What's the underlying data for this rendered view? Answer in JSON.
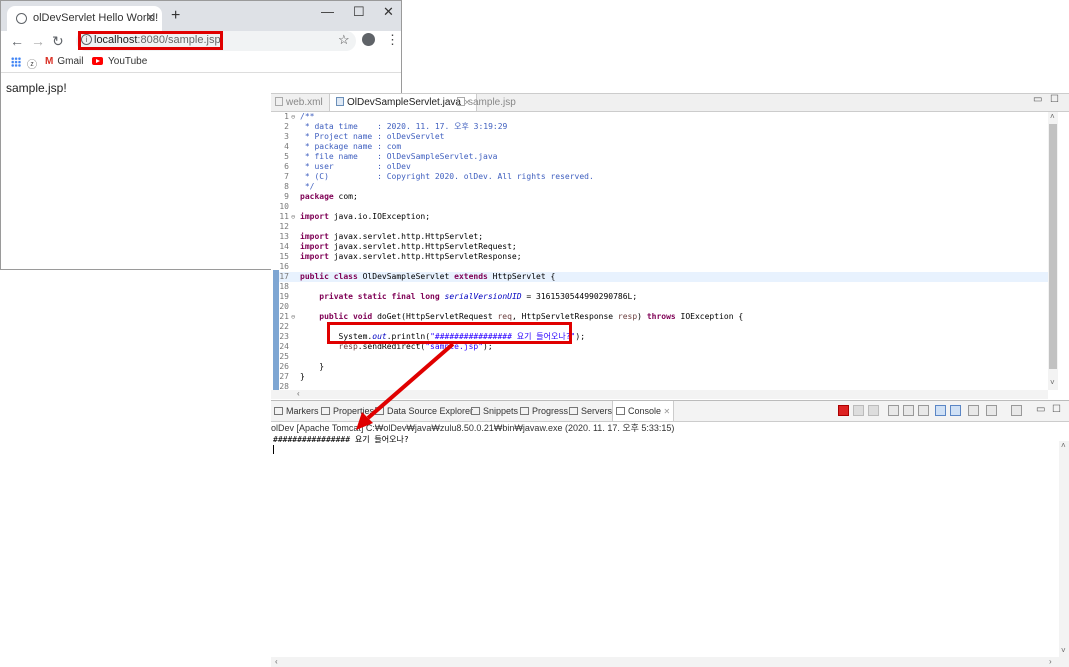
{
  "browser": {
    "tab_title": "olDevServlet Hello World!",
    "tab_close": "×",
    "new_tab": "+",
    "window_minimize": "—",
    "window_maximize": "☐",
    "window_close": "✕",
    "back": "←",
    "forward": "→",
    "reload": "↻",
    "info": "i",
    "url_host": "localhost",
    "url_rest": ":8080/sample.jsp",
    "star": "☆",
    "menu": "⋮",
    "bookmarks": [
      {
        "label": "Gmail",
        "icon": "gmail-icon"
      },
      {
        "label": "YouTube",
        "icon": "youtube-icon"
      }
    ],
    "gmail_letter": "M",
    "extra_bookmark": "ⓩ",
    "page_text": "sample.jsp!",
    "highlight_color": "#e00000"
  },
  "editor": {
    "tabs": [
      {
        "label": "web.xml",
        "active": false
      },
      {
        "label": "OlDevSampleServlet.java",
        "active": true,
        "close": "✕"
      },
      {
        "label": "sample.jsp",
        "active": false
      }
    ],
    "minimize": "▭",
    "maximize": "☐",
    "lines": [
      {
        "n": "1",
        "fold": "⊖",
        "parts": [
          [
            "c-comment",
            "/**"
          ]
        ]
      },
      {
        "n": "2",
        "parts": [
          [
            "c-comment",
            " * data time    : 2020. 11. 17. 오후 3:19:29"
          ]
        ]
      },
      {
        "n": "3",
        "parts": [
          [
            "c-comment",
            " * Project name : olDevServlet"
          ]
        ]
      },
      {
        "n": "4",
        "parts": [
          [
            "c-comment",
            " * package name : com"
          ]
        ]
      },
      {
        "n": "5",
        "parts": [
          [
            "c-comment",
            " * file name    : OlDevSampleServlet.java"
          ]
        ]
      },
      {
        "n": "6",
        "parts": [
          [
            "c-comment",
            " * user         : olDev"
          ]
        ]
      },
      {
        "n": "7",
        "parts": [
          [
            "c-comment",
            " * (C)          : Copyright 2020. olDev. All rights reserved."
          ]
        ]
      },
      {
        "n": "8",
        "parts": [
          [
            "c-comment",
            " */"
          ]
        ]
      },
      {
        "n": "9",
        "parts": [
          [
            "c-kw",
            "package"
          ],
          [
            "c-plain",
            " com;"
          ]
        ]
      },
      {
        "n": "10",
        "parts": []
      },
      {
        "n": "11",
        "fold": "⊖",
        "parts": [
          [
            "c-kw",
            "import"
          ],
          [
            "c-plain",
            " java.io.IOException;"
          ]
        ]
      },
      {
        "n": "12",
        "parts": []
      },
      {
        "n": "13",
        "parts": [
          [
            "c-kw",
            "import"
          ],
          [
            "c-plain",
            " javax.servlet.http.HttpServlet;"
          ]
        ]
      },
      {
        "n": "14",
        "parts": [
          [
            "c-kw",
            "import"
          ],
          [
            "c-plain",
            " javax.servlet.http.HttpServletRequest;"
          ]
        ]
      },
      {
        "n": "15",
        "parts": [
          [
            "c-kw",
            "import"
          ],
          [
            "c-plain",
            " javax.servlet.http.HttpServletResponse;"
          ]
        ]
      },
      {
        "n": "16",
        "parts": []
      },
      {
        "n": "17",
        "current": true,
        "parts": [
          [
            "c-kw",
            "public class"
          ],
          [
            "c-plain",
            " OlDevSampleServlet "
          ],
          [
            "c-kw",
            "extends"
          ],
          [
            "c-plain",
            " HttpServlet {"
          ]
        ]
      },
      {
        "n": "18",
        "parts": []
      },
      {
        "n": "19",
        "parts": [
          [
            "c-plain",
            "    "
          ],
          [
            "c-kw",
            "private static final long"
          ],
          [
            "c-plain",
            " "
          ],
          [
            "c-field",
            "serialVersionUID"
          ],
          [
            "c-plain",
            " = 3161530544990290786L;"
          ]
        ]
      },
      {
        "n": "20",
        "parts": []
      },
      {
        "n": "21",
        "fold": "⊖",
        "parts": [
          [
            "c-plain",
            "    "
          ],
          [
            "c-kw",
            "public void"
          ],
          [
            "c-plain",
            " doGet(HttpServletRequest "
          ],
          [
            "c-var",
            "req"
          ],
          [
            "c-plain",
            ", HttpServletResponse "
          ],
          [
            "c-var",
            "resp"
          ],
          [
            "c-plain",
            ") "
          ],
          [
            "c-kw",
            "throws"
          ],
          [
            "c-plain",
            " IOException {"
          ]
        ]
      },
      {
        "n": "22",
        "parts": []
      },
      {
        "n": "23",
        "parts": [
          [
            "c-plain",
            "        System."
          ],
          [
            "c-field",
            "out"
          ],
          [
            "c-plain",
            ".println("
          ],
          [
            "c-str",
            "\"################ 요기 들어오나?\""
          ],
          [
            "c-plain",
            ");"
          ]
        ]
      },
      {
        "n": "24",
        "parts": [
          [
            "c-plain",
            "        "
          ],
          [
            "c-var",
            "resp"
          ],
          [
            "c-plain",
            ".sendRedirect("
          ],
          [
            "c-str",
            "\"sample.jsp\""
          ],
          [
            "c-plain",
            ");"
          ]
        ]
      },
      {
        "n": "25",
        "parts": []
      },
      {
        "n": "26",
        "parts": [
          [
            "c-plain",
            "    }"
          ]
        ]
      },
      {
        "n": "27",
        "parts": [
          [
            "c-plain",
            "}"
          ]
        ]
      },
      {
        "n": "28",
        "parts": []
      }
    ]
  },
  "console": {
    "tabs": [
      {
        "label": "Markers",
        "icon": "markers-icon"
      },
      {
        "label": "Properties",
        "icon": "properties-icon"
      },
      {
        "label": "Data Source Explorer",
        "icon": "data-source-icon"
      },
      {
        "label": "Snippets",
        "icon": "snippets-icon"
      },
      {
        "label": "Progress",
        "icon": "progress-icon"
      },
      {
        "label": "Servers",
        "icon": "servers-icon"
      },
      {
        "label": "Console",
        "icon": "console-icon",
        "active": true,
        "close": "✕"
      }
    ],
    "minimize": "▭",
    "maximize": "☐",
    "launch_info": "olDev [Apache Tomcat] C:₩olDev₩java₩zulu8.50.0.21₩bin₩javaw.exe (2020. 11. 17. 오후 5:33:15)",
    "output": "################ 요기 들어오나?"
  }
}
